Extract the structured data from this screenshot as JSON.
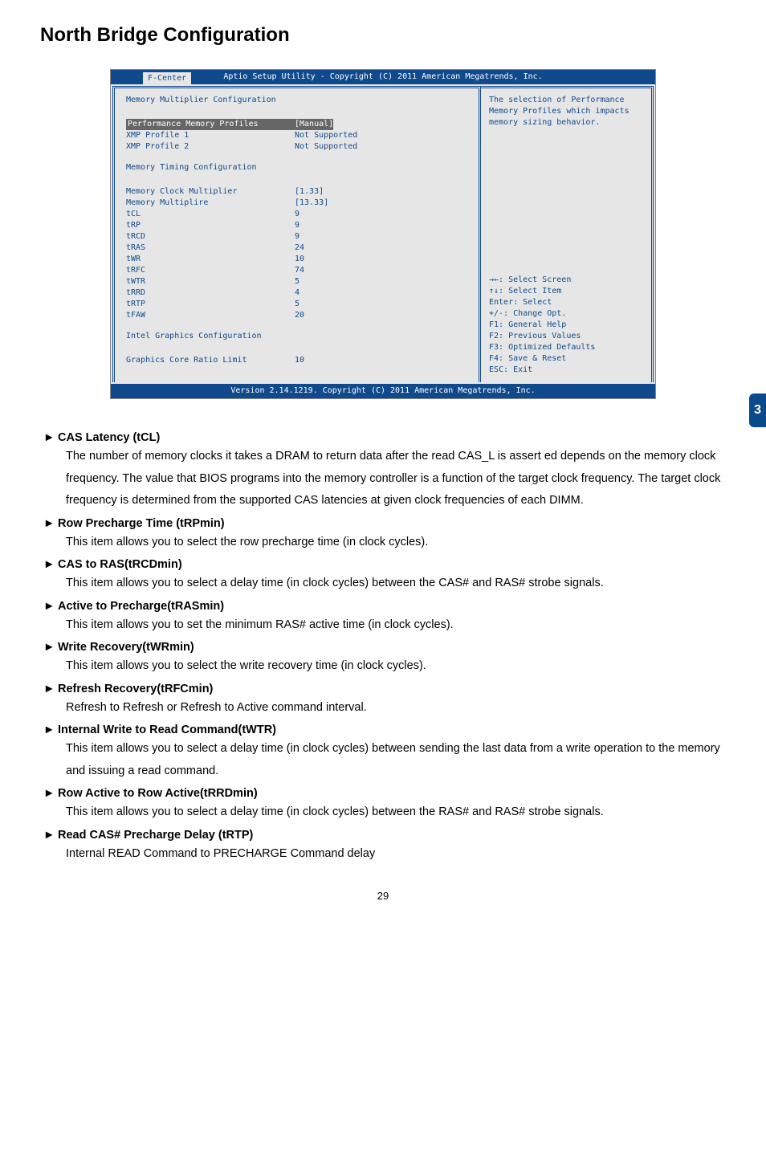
{
  "page_tab": "3",
  "title": "North Bridge Configuration",
  "bios": {
    "header": "Aptio Setup Utility - Copyright (C) 2011 American Megatrends, Inc.",
    "tab": "F-Center",
    "section1": "Memory Multiplier Configuration",
    "rows1": [
      {
        "label": "Performance Memory Profiles",
        "value": "[Manual]",
        "selected": true
      },
      {
        "label": "XMP Profile 1",
        "value": "Not Supported"
      },
      {
        "label": "XMP Profile 2",
        "value": "Not Supported"
      }
    ],
    "section2": "Memory Timing Configuration",
    "rows2": [
      {
        "label": "Memory Clock Multiplier",
        "value": "[1.33]"
      },
      {
        "label": "Memory Multiplire",
        "value": "[13.33]"
      },
      {
        "label": "tCL",
        "value": "9"
      },
      {
        "label": "tRP",
        "value": "9"
      },
      {
        "label": "tRCD",
        "value": "9"
      },
      {
        "label": "tRAS",
        "value": "24"
      },
      {
        "label": "tWR",
        "value": "10"
      },
      {
        "label": "tRFC",
        "value": "74"
      },
      {
        "label": "tWTR",
        "value": "5"
      },
      {
        "label": "tRRD",
        "value": "4"
      },
      {
        "label": "tRTP",
        "value": "5"
      },
      {
        "label": "tFAW",
        "value": "20"
      }
    ],
    "section3": "Intel Graphics Configuration",
    "rows3": [
      {
        "label": "Graphics Core Ratio Limit",
        "value": "10"
      }
    ],
    "help_desc": "The selection of Performance Memory Profiles which impacts memory sizing behavior.",
    "help_keys": [
      "→←: Select Screen",
      "↑↓: Select Item",
      "Enter: Select",
      "+/-: Change Opt.",
      "F1: General Help",
      "F2: Previous Values",
      "F3: Optimized Defaults",
      "F4: Save & Reset",
      "ESC: Exit"
    ],
    "footer": "Version 2.14.1219. Copyright (C) 2011 American Megatrends, Inc."
  },
  "doc": [
    {
      "head": "CAS Latency (tCL)",
      "text": "The number of memory clocks it takes a DRAM to return data after the read CAS_L is assert ed depends on the memory clock frequency. The value that BIOS programs into the memory controller is a function of the target clock frequency. The target clock frequency is determined from the supported CAS latencies at given clock frequencies of each DIMM."
    },
    {
      "head": "Row Precharge Time (tRPmin)",
      "text": "This item allows you to select the row precharge time (in clock cycles)."
    },
    {
      "head": "CAS to RAS(tRCDmin)",
      "text": "This item allows you to select a delay time (in clock cycles) between the CAS# and RAS# strobe signals."
    },
    {
      "head": "Active to Precharge(tRASmin)",
      "text": "This item allows you to set the minimum RAS# active time (in clock cycles)."
    },
    {
      "head": "Write Recovery(tWRmin)",
      "text": "This item allows you to select the write recovery time (in clock cycles)."
    },
    {
      "head": "Refresh Recovery(tRFCmin)",
      "text": "Refresh to Refresh or Refresh to Active command interval."
    },
    {
      "head": "Internal Write to Read Command(tWTR)",
      "text": "This item allows you to select a delay time (in clock cycles) between sending the last data from a write operation to the memory and issuing a read command."
    },
    {
      "head": "Row Active to Row Active(tRRDmin)",
      "text": "This item allows you to select a delay time (in clock cycles) between the RAS# and RAS# strobe signals."
    },
    {
      "head": "Read CAS# Precharge Delay (tRTP)",
      "text": "Internal READ Command to PRECHARGE Command delay"
    }
  ],
  "page_num": "29"
}
